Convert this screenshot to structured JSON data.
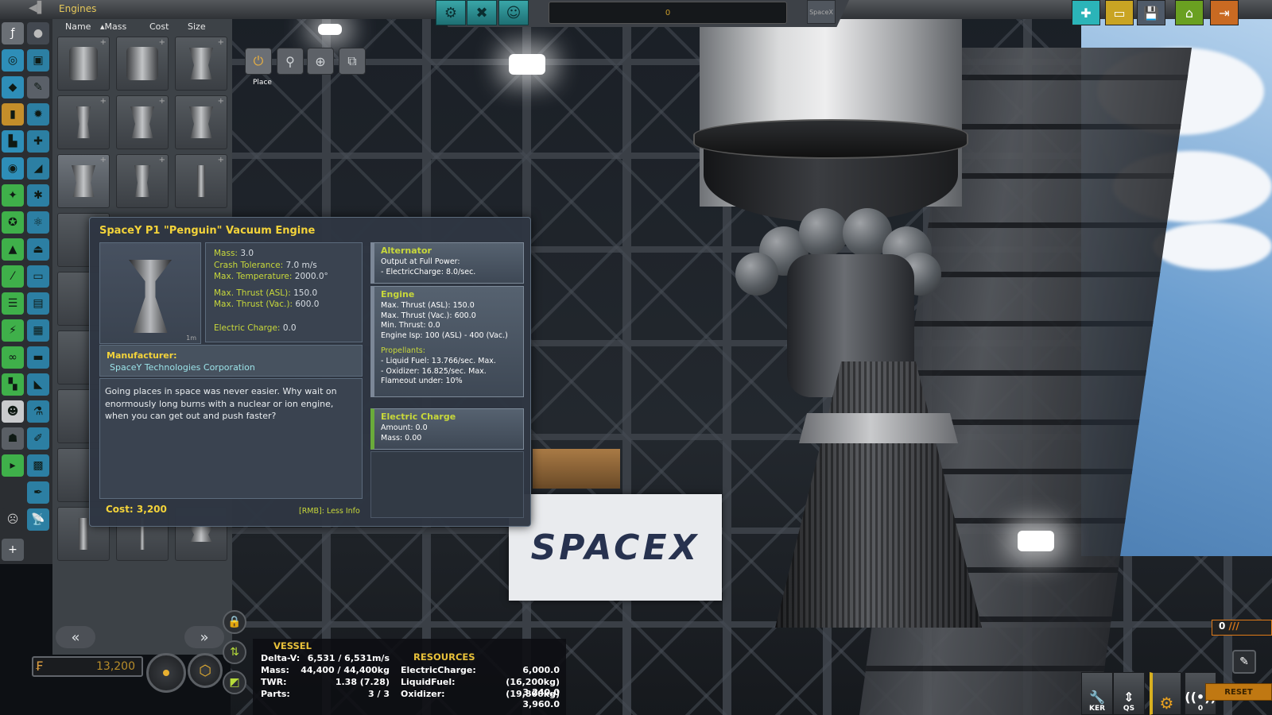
{
  "topbar": {
    "title": "Engines",
    "ship_name": "0",
    "flag_text": "SpaceX"
  },
  "sort_bar": {
    "name": "Name",
    "mass": "Mass",
    "cost": "Cost",
    "size": "Size"
  },
  "action_groups": {
    "label": "Place"
  },
  "banner": {
    "text": "SPACEX"
  },
  "tooltip": {
    "title": "SpaceY P1 \"Penguin\" Vacuum Engine",
    "scale": "1m",
    "stats": [
      {
        "label": "Mass:",
        "value": "3.0"
      },
      {
        "label": "Crash Tolerance:",
        "value": "7.0 m/s"
      },
      {
        "label": "Max. Temperature:",
        "value": "2000.0°"
      },
      {
        "label": "Max. Thrust (ASL):",
        "value": "150.0"
      },
      {
        "label": "Max. Thrust (Vac.):",
        "value": "600.0"
      },
      {
        "label": "Electric Charge:",
        "value": "0.0"
      }
    ],
    "manufacturer_label": "Manufacturer:",
    "manufacturer": "SpaceY Technologies Corporation",
    "description": "Going places in space was never easier. Why wait on enormously long burns with a nuclear or ion engine, when you can get out and push faster?",
    "cost": "Cost: 3,200",
    "rmb": "[RMB]: Less Info",
    "modules": [
      {
        "title": "Alternator",
        "lines": [
          "Output at Full Power:",
          "- ElectricCharge: 8.0/sec."
        ]
      },
      {
        "title": "Engine",
        "lines": [
          "Max. Thrust (ASL): 150.0",
          "Max. Thrust (Vac.): 600.0",
          "Min. Thrust: 0.0",
          "Engine Isp: 100 (ASL) - 400 (Vac.)"
        ],
        "sub_title": "Propellants:",
        "sub_lines": [
          "- Liquid Fuel: 13.766/sec. Max.",
          "- Oxidizer: 16.825/sec. Max.",
          "Flameout under: 10%"
        ]
      },
      {
        "title": "Electric Charge",
        "lines": [
          "Amount: 0.0",
          "Mass: 0.00"
        ]
      }
    ]
  },
  "funds": "13,200",
  "ker": {
    "vessel_header": "VESSEL",
    "resources_header": "RESOURCES",
    "vessel": [
      {
        "label": "Delta-V:",
        "value": "6,531 / 6,531m/s"
      },
      {
        "label": "Mass:",
        "value": "44,400 / 44,400kg"
      },
      {
        "label": "TWR:",
        "value": "1.38 (7.28)"
      },
      {
        "label": "Parts:",
        "value": "3 / 3"
      }
    ],
    "resources": [
      {
        "label": "ElectricCharge:",
        "value": "6,000.0"
      },
      {
        "label": "LiquidFuel:",
        "value": "(16,200kg) 3,240.0"
      },
      {
        "label": "Oxidizer:",
        "value": "(19,800kg) 3,960.0"
      }
    ]
  },
  "bottom_right": {
    "ker_label": "KER",
    "qs_label": "QS",
    "antenna_count": "0",
    "stage_count": "0",
    "reset": "RESET"
  }
}
